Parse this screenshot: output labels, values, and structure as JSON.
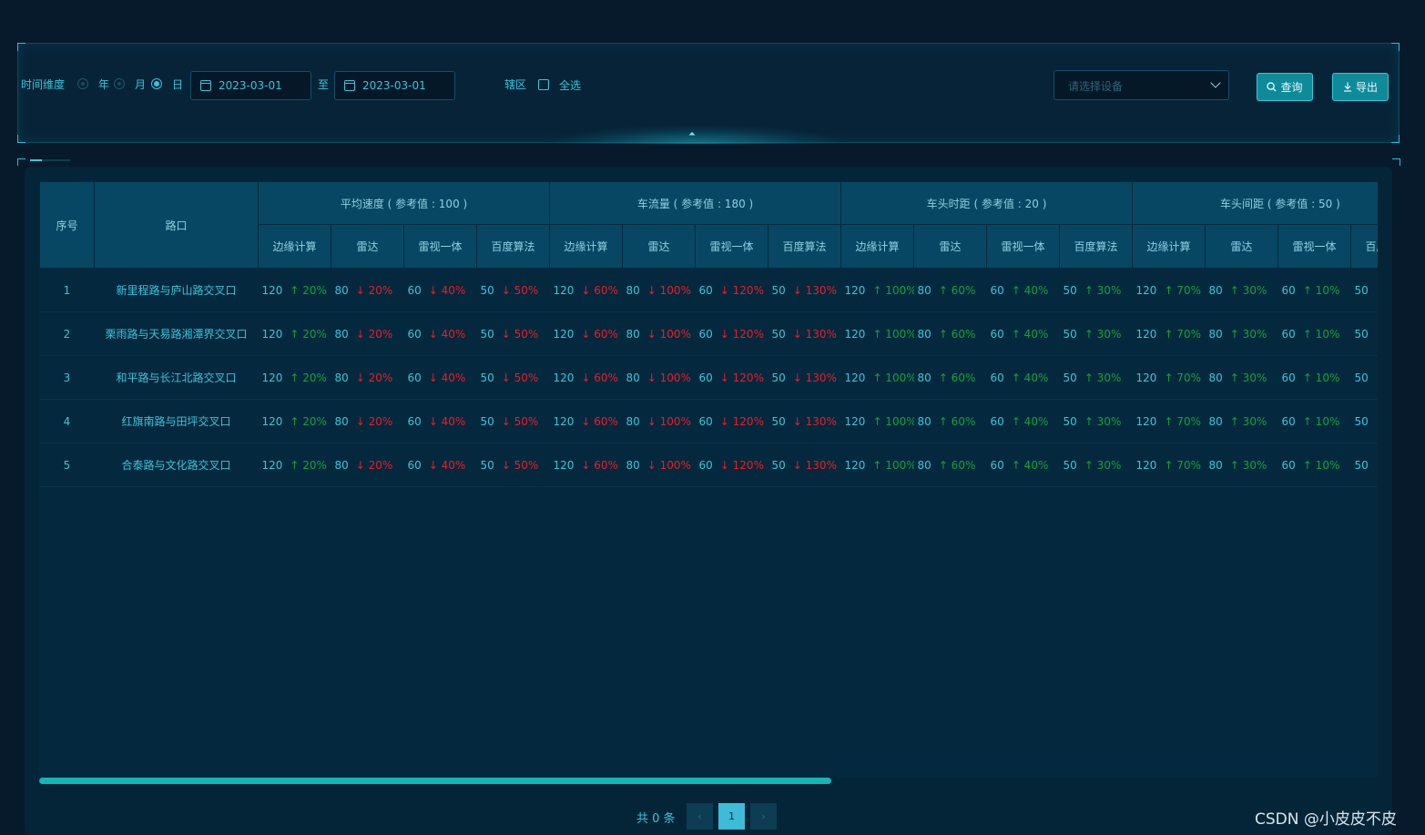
{
  "filter": {
    "time_dim_label": "时间维度",
    "radio_year": "年",
    "radio_month": "月",
    "radio_day": "日",
    "selected": "日",
    "date_start": "2023-03-01",
    "to_label": "至",
    "date_end": "2023-03-01",
    "district_label": "辖区",
    "select_all": "全选",
    "device_placeholder": "请选择设备",
    "query_btn": "查询",
    "export_btn": "导出"
  },
  "table": {
    "col_index": "序号",
    "col_road": "路口",
    "groups": [
      "平均速度 ( 参考值 : 100 )",
      "车流量 ( 参考值 : 180 )",
      "车头时距 ( 参考值 : 20 )",
      "车头间距 ( 参考值 : 50 )"
    ],
    "sub_headers": [
      "边缘计算",
      "雷达",
      "雷视一体",
      "百度算法"
    ],
    "row_names": [
      "新里程路与庐山路交叉口",
      "栗雨路与天易路湘潭界交叉口",
      "和平路与长江北路交叉口",
      "红旗南路与田坪交叉口",
      "合泰路与文化路交叉口"
    ],
    "cells": [
      {
        "v": "120",
        "d": "up",
        "p": "↑ 20%"
      },
      {
        "v": "80",
        "d": "down",
        "p": "↓ 20%"
      },
      {
        "v": "60",
        "d": "down",
        "p": "↓ 40%"
      },
      {
        "v": "50",
        "d": "down",
        "p": "↓ 50%"
      },
      {
        "v": "120",
        "d": "down",
        "p": "↓ 60%"
      },
      {
        "v": "80",
        "d": "down",
        "p": "↓ 100%"
      },
      {
        "v": "60",
        "d": "down",
        "p": "↓ 120%"
      },
      {
        "v": "50",
        "d": "down",
        "p": "↓ 130%"
      },
      {
        "v": "120",
        "d": "up",
        "p": "↑ 100%"
      },
      {
        "v": "80",
        "d": "up",
        "p": "↑ 60%"
      },
      {
        "v": "60",
        "d": "up",
        "p": "↑ 40%"
      },
      {
        "v": "50",
        "d": "up",
        "p": "↑ 30%"
      },
      {
        "v": "120",
        "d": "up",
        "p": "↑ 70%"
      },
      {
        "v": "80",
        "d": "up",
        "p": "↑ 30%"
      },
      {
        "v": "60",
        "d": "up",
        "p": "↑ 10%"
      },
      {
        "v": "50",
        "d": "up",
        "p": ""
      }
    ]
  },
  "pager": {
    "total": "共 0 条",
    "current": "1",
    "prev": "‹",
    "next": "›"
  },
  "watermark": "CSDN @小皮皮不皮",
  "colors": {
    "accent": "#39c6dc",
    "up": "#11a43a",
    "down": "#ee1c24",
    "header_bg": "#074763"
  },
  "icons": {
    "calendar": "calendar-icon",
    "search": "search-icon",
    "download": "download-icon",
    "chevron": "chevron-down-icon",
    "collapse": "collapse-up-icon"
  }
}
